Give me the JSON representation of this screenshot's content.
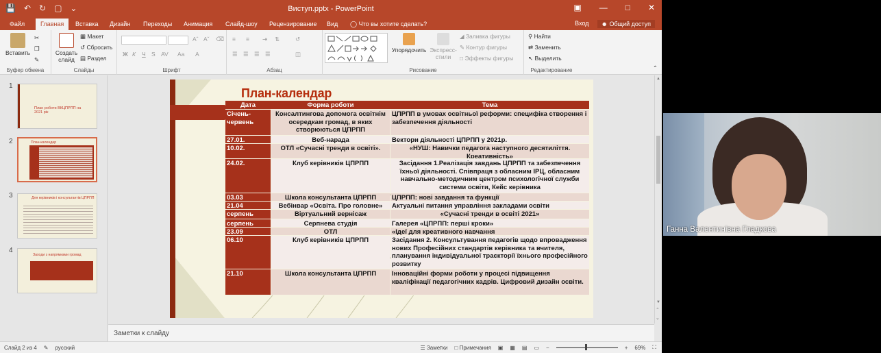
{
  "titlebar": {
    "title": "Виступ.pptx - PowerPoint",
    "quick_access": [
      "save-icon",
      "undo-icon",
      "redo-icon",
      "slideshow-icon"
    ],
    "window_controls": [
      "ribbon-display-icon",
      "minimize-icon",
      "maximize-icon",
      "close-icon"
    ]
  },
  "tabs": [
    "Файл",
    "Главная",
    "Вставка",
    "Дизайн",
    "Переходы",
    "Анимация",
    "Слайд-шоу",
    "Рецензирование",
    "Вид",
    "Что вы хотите сделать?"
  ],
  "active_tab": "Главная",
  "account": {
    "signin": "Вход",
    "share": "Общий доступ"
  },
  "ribbon": {
    "clipboard": {
      "paste": "Вставить",
      "name": "Буфер обмена"
    },
    "slides": {
      "new_slide": "Создать слайд",
      "layout": "Макет",
      "reset": "Сбросить",
      "section": "Раздел",
      "name": "Слайды"
    },
    "font": {
      "bold": "Ж",
      "italic": "К",
      "underline": "Ч",
      "strike": "S",
      "name": "Шрифт"
    },
    "paragraph": {
      "name": "Абзац"
    },
    "drawing": {
      "arrange": "Упорядочить",
      "quick_styles": "Экспресс-стили",
      "fill": "Заливка фигуры",
      "outline": "Контур фигуры",
      "effects": "Эффекты фигуры",
      "name": "Рисование"
    },
    "editing": {
      "find": "Найти",
      "replace": "Заменить",
      "select": "Выделить",
      "name": "Редактирование"
    }
  },
  "thumbnails": [
    {
      "num": "1",
      "title": "План роботи  ВКЦПРПП на 2021 рік"
    },
    {
      "num": "2",
      "title": "План-календар"
    },
    {
      "num": "3",
      "title": "Для керівників і консультантів ЦПРПП"
    },
    {
      "num": "4",
      "title": "Заходи з напрямками громад"
    }
  ],
  "slide": {
    "title": "План-календар",
    "headers": [
      "Дата",
      "Форма роботи",
      "Тема"
    ],
    "rows": [
      {
        "date": "Січень-червень",
        "form": "Консалтингова допомога освітнім осередкам громад, в яких створюються ЦПРПП",
        "topic": "ЦПРПП в умовах освітньої реформи: специфіка створення і забезпечення діяльності"
      },
      {
        "date": "27.01.",
        "form": "Веб-нарада",
        "topic": "Вектори діяльності  ЦПРПП у 2021р."
      },
      {
        "date": "10.02.",
        "form": "ОТЛ «Сучасні тренди в освіті».",
        "topic": "«НУШ:  Навички педагога наступного десятиліття. Креативність»"
      },
      {
        "date": "24.02.",
        "form": "Клуб керівників ЦПРПП",
        "topic": "Засідання 1.Реалізація завдань ЦПРПП та забезпечення їхньої діяльності. Співпраця з обласним ІРЦ, обласним навчально-методичним центром психологічної служби системи освіти, Кейс керівника"
      },
      {
        "date": "03.03",
        "form": "Школа консультанта ЦПРПП",
        "topic": "ЦПРПП: нові завдання та функції"
      },
      {
        "date": "21.04",
        "form": "Вебінвар  «Освіта. Про головне»",
        "topic": " Актуальні питання управління закладами освіти"
      },
      {
        "date": "серпень",
        "form": "Віртуальний вернісаж",
        "topic": "«Сучасні тренди в освіті 2021»"
      },
      {
        "date": "серпень",
        "form": "Серпнева студія",
        "topic": "Галерея «ЦПРПП: перші кроки»"
      },
      {
        "date": "23.09",
        "form": "ОТЛ",
        "topic": "«Ідеї для креативного навчання"
      },
      {
        "date": "06.10",
        "form": "Клуб керівників ЦПРПП",
        "topic": "Засідання 2. Консультування педагогів щодо впровадження нових Професійних стандартів керівника та вчителя, планування індивідуальної траєкторії  їхнього професійного розвитку"
      },
      {
        "date": "21.10",
        "form": "Школа консультанта ЦПРПП",
        "topic": "Інноваційні форми роботи у процесі підвищення кваліфікації педагогічних кадрів. Цифровий дизайн освіти."
      }
    ]
  },
  "notes_placeholder": "Заметки к слайду",
  "status": {
    "slide": "Слайд 2 из 4",
    "language": "русский",
    "notes": "Заметки",
    "comments": "Примечания",
    "zoom": "69%",
    "zoom_level": 0.69
  },
  "video": {
    "name": "Ганна Валентинівна Гладкова"
  },
  "colors": {
    "accent": "#b7472a",
    "table_header": "#a6311b",
    "slide_title": "#b52d0d"
  }
}
